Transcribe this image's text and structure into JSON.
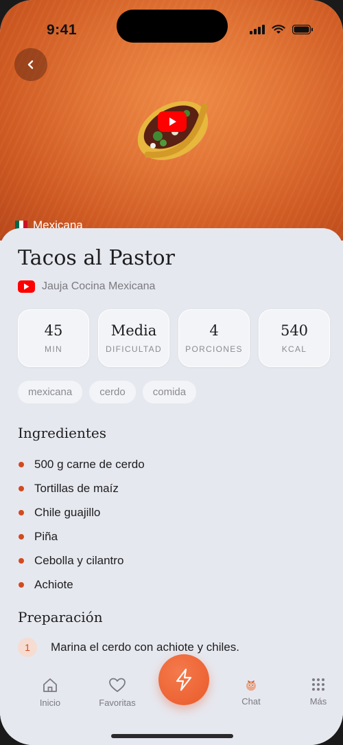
{
  "status_bar": {
    "time": "9:41"
  },
  "hero": {
    "cuisine": "Mexicana",
    "flag_colors": [
      "#006847",
      "#ffffff",
      "#ce1126"
    ]
  },
  "recipe": {
    "title": "Tacos al Pastor",
    "channel": "Jauja Cocina Mexicana",
    "stats": [
      {
        "value": "45",
        "label": "MIN"
      },
      {
        "value": "Media",
        "label": "DIFICULTAD"
      },
      {
        "value": "4",
        "label": "PORCIONES"
      },
      {
        "value": "540",
        "label": "KCAL"
      }
    ],
    "tags": [
      "mexicana",
      "cerdo",
      "comida"
    ],
    "ingredients_title": "Ingredientes",
    "ingredients": [
      "500 g carne de cerdo",
      "Tortillas de maíz",
      "Chile guajillo",
      "Piña",
      "Cebolla y cilantro",
      "Achiote"
    ],
    "preparation_title": "Preparación",
    "steps": [
      {
        "number": "1",
        "text": "Marina el cerdo con achiote y chiles."
      }
    ]
  },
  "tab_bar": {
    "items": [
      {
        "label": "Inicio",
        "icon": "home-icon"
      },
      {
        "label": "Favoritas",
        "icon": "heart-icon"
      },
      {
        "label": "Chat",
        "icon": "chat-mascot-icon"
      },
      {
        "label": "Más",
        "icon": "grid-icon"
      }
    ],
    "fab_icon": "lightning-icon"
  },
  "colors": {
    "accent": "#ea5a2a",
    "youtube": "#ff0000",
    "background": "#e6e8ef",
    "hero": "#e27536"
  }
}
